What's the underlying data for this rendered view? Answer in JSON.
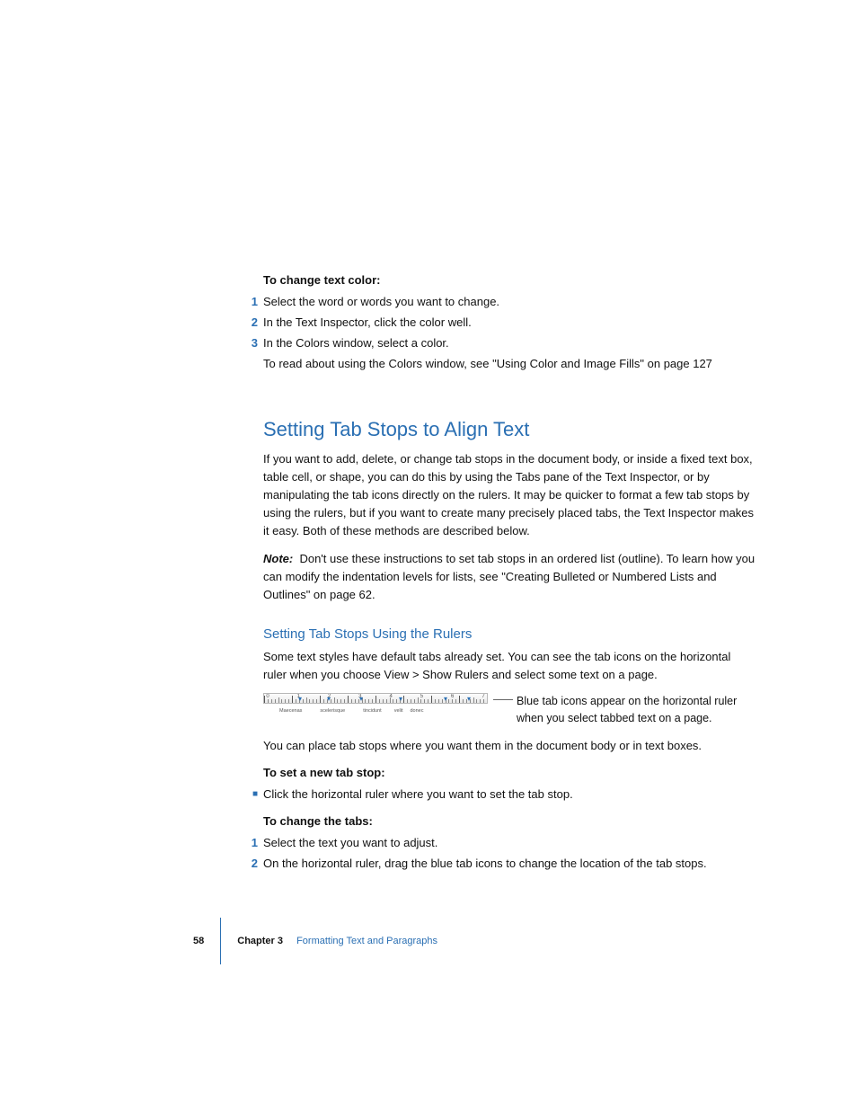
{
  "intro": {
    "heading": "To change text color:",
    "steps": [
      "Select the word or words you want to change.",
      "In the Text Inspector, click the color well.",
      "In the Colors window, select a color."
    ],
    "followup": "To read about using the Colors window, see \"Using Color and Image Fills\" on page 127"
  },
  "section": {
    "title": "Setting Tab Stops to Align Text",
    "para": "If you want to add, delete, or change tab stops in the document body, or inside a fixed text box, table cell, or shape, you can do this by using the Tabs pane of the Text Inspector, or by manipulating the tab icons directly on the rulers. It may be quicker to format a few tab stops by using the rulers, but if you want to create many precisely placed tabs, the Text Inspector makes it easy. Both of these methods are described below.",
    "note_label": "Note:",
    "note": "Don't use these instructions to set tab stops in an ordered list (outline). To learn how you can modify the indentation levels for lists, see \"Creating Bulleted or Numbered Lists and Outlines\" on page 62."
  },
  "subsection": {
    "title": "Setting Tab Stops Using the Rulers",
    "para": "Some text styles have default tabs already set. You can see the tab icons on the horizontal ruler when you choose View > Show Rulers and select some text on a page.",
    "callout": "Blue tab icons appear on the horizontal ruler when you select tabbed text on a page.",
    "sample_words": [
      "Maecenas",
      "scelerisque",
      "tincidunt",
      "velit",
      "donec"
    ],
    "after_fig": "You can place tab stops where you want them in the document body or in text boxes.",
    "set_new": {
      "heading": "To set a new tab stop:",
      "step": "Click the horizontal ruler where you want to set the tab stop."
    },
    "change_tabs": {
      "heading": "To change the tabs:",
      "steps": [
        "Select the text you want to adjust.",
        "On the horizontal ruler, drag the blue tab icons to change the location of the tab stops."
      ]
    }
  },
  "footer": {
    "page": "58",
    "chapter": "Chapter 3",
    "title": "Formatting Text and Paragraphs"
  }
}
